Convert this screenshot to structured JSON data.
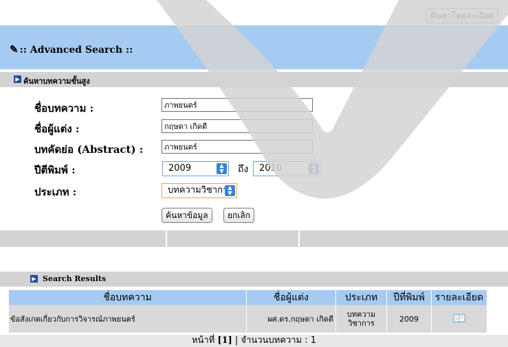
{
  "top_button": "ค้นหาโดยละเอียด",
  "header": {
    "title": ":: Advanced Search ::"
  },
  "search_section": {
    "label": "ค้นหาบทความขั้นสูง"
  },
  "form": {
    "title_label": "ชื่อบทความ :",
    "title_value": "ภาพยนตร์",
    "author_label": "ชื่อผู้แต่ง :",
    "author_value": "กฤษดา เกิดดี",
    "abstract_label": "บทคัดย่อ (Abstract) :",
    "abstract_value": "ภาพยนตร์",
    "year_label": "ปีตีพิมพ์ :",
    "year_from": "2009",
    "to_label": "ถึง",
    "year_to": "2010",
    "type_label": "ประเภท :",
    "type_value": "บทความวิชาการ",
    "search_button": "ค้นหาข้อมูล",
    "cancel_button": "ยกเลิก"
  },
  "results_section": {
    "label": "Search Results"
  },
  "results": {
    "columns": [
      "ชื่อบทความ",
      "ชื่อผู้แต่ง",
      "ประเภท",
      "ปีที่พิมพ์",
      "รายละเอียด"
    ],
    "rows": [
      {
        "title": "ข้อสังเกตเกี่ยวกับการวิจารณ์ภาพยนตร์",
        "author": "ผศ.ดร.กฤษดา เกิดดี",
        "type": "บทความวิชาการ",
        "year": "2009",
        "detail_icon": "book-icon"
      }
    ]
  },
  "pager": {
    "page_label": "หน้าที่",
    "page_value": "[1]",
    "separator": "|",
    "count_label": "จำนวนบทความ : 1"
  }
}
